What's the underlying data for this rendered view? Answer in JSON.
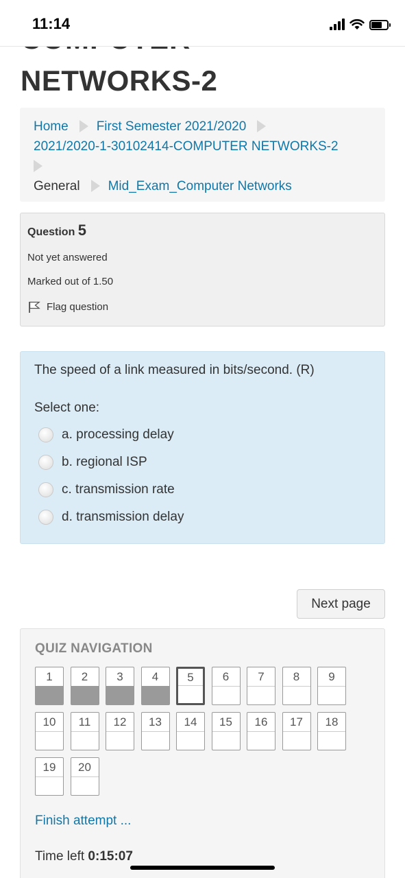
{
  "status": {
    "time": "11:14"
  },
  "page": {
    "cut_title": "COMPUTER",
    "title": "NETWORKS-2"
  },
  "breadcrumb": {
    "home": "Home",
    "semester": "First Semester 2021/2020",
    "course": "2021/2020-1-30102414-COMPUTER NETWORKS-2",
    "section": "General",
    "quiz": "Mid_Exam_Computer Networks"
  },
  "question_info": {
    "label": "Question",
    "number": "5",
    "state": "Not yet answered",
    "marks": "Marked out of 1.50",
    "flag_label": "Flag question"
  },
  "question": {
    "text": "The speed of a link measured in bits/second. (R)",
    "prompt": "Select one:",
    "options": [
      "a. processing delay",
      "b. regional ISP",
      "c. transmission rate",
      "d. transmission delay"
    ]
  },
  "next_button": "Next page",
  "quiz_navigation": {
    "title": "QUIZ NAVIGATION",
    "buttons": [
      "1",
      "2",
      "3",
      "4",
      "5",
      "6",
      "7",
      "8",
      "9",
      "10",
      "11",
      "12",
      "13",
      "14",
      "15",
      "16",
      "17",
      "18",
      "19",
      "20"
    ],
    "answered": [
      1,
      2,
      3,
      4
    ],
    "current": 5,
    "finish_link": "Finish attempt ...",
    "time_label": "Time left",
    "time_value": "0:15:07"
  }
}
